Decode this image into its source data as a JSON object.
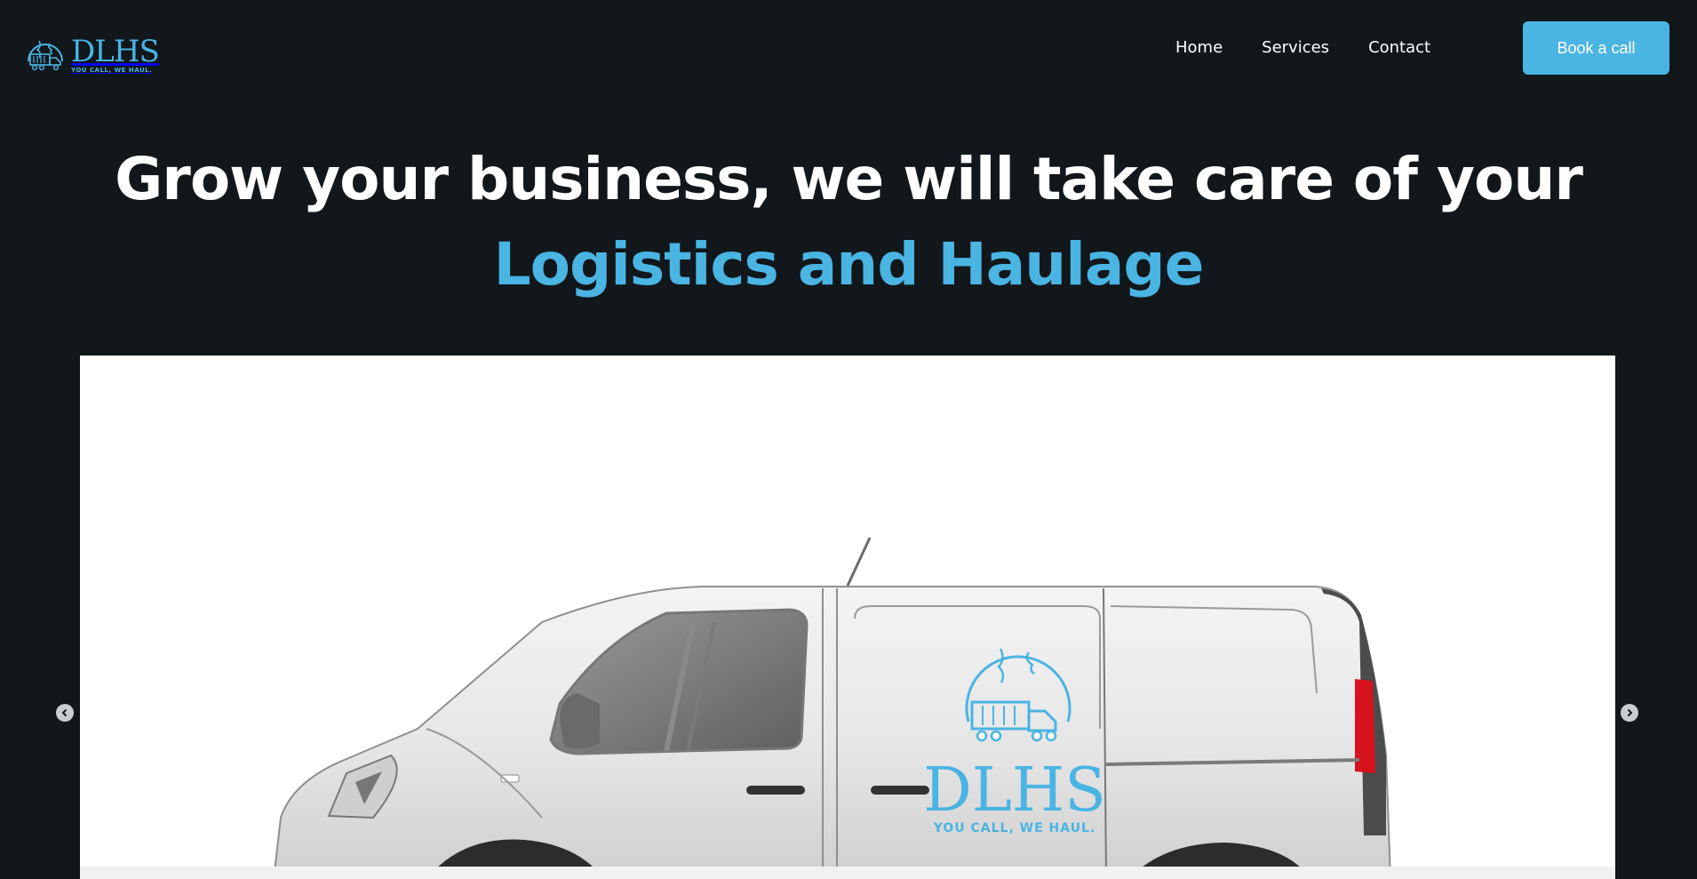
{
  "brand": {
    "wordmark": "DLHS",
    "tagline": "YOU CALL, WE HAUL."
  },
  "nav": {
    "home": "Home",
    "services": "Services",
    "contact": "Contact"
  },
  "cta": {
    "label": "Book a call"
  },
  "hero": {
    "title": "Grow your business, we will take care of your",
    "accent": "Logistics and Haulage"
  },
  "slide": {
    "van_logo_wordmark": "DLHS",
    "van_logo_tagline": "YOU CALL, WE HAUL."
  },
  "icons": {
    "prev": "chevron-left-icon",
    "next": "chevron-right-icon"
  },
  "colors": {
    "background": "#11171b",
    "accent": "#4ab4e2",
    "text": "#ffffff"
  }
}
